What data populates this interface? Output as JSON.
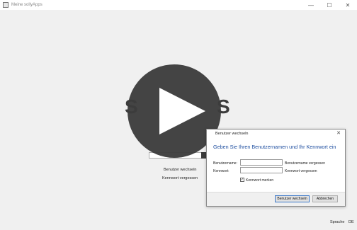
{
  "window": {
    "title": "Meine sollyApps",
    "minimize_glyph": "—",
    "maximize_glyph": "☐",
    "close_glyph": "✕"
  },
  "background": {
    "logo_left_fragment": "S",
    "logo_right_fragment": "S",
    "switch_user_link": "Benutzer wechseln",
    "forgot_password_link": "Kennwort vergessen"
  },
  "statusbar": {
    "language_label": "Sprache",
    "language_value": "DE"
  },
  "dialog": {
    "title": "Benutzer wechseln",
    "close_glyph": "✕",
    "heading": "Geben Sie Ihren Benutzernamen und Ihr Kennwort ein",
    "username_label": "Benutzername:",
    "username_value": "",
    "forgot_username_link": "Benutzername vergessen",
    "password_label": "Kennwort:",
    "password_value": "",
    "forgot_password_link": "Kennwort vergessen",
    "remember_label": "Kennwort merken",
    "remember_checked": true,
    "remember_glyph": "✓",
    "ok_button": "Benutzer wechseln",
    "cancel_button": "Abbrechen"
  },
  "icons": {
    "app": "app-window-icon",
    "play": "play-icon"
  },
  "colors": {
    "heading": "#1f4fa0",
    "primary_border": "#3c78c8",
    "overlay": "#3c3c3c"
  }
}
